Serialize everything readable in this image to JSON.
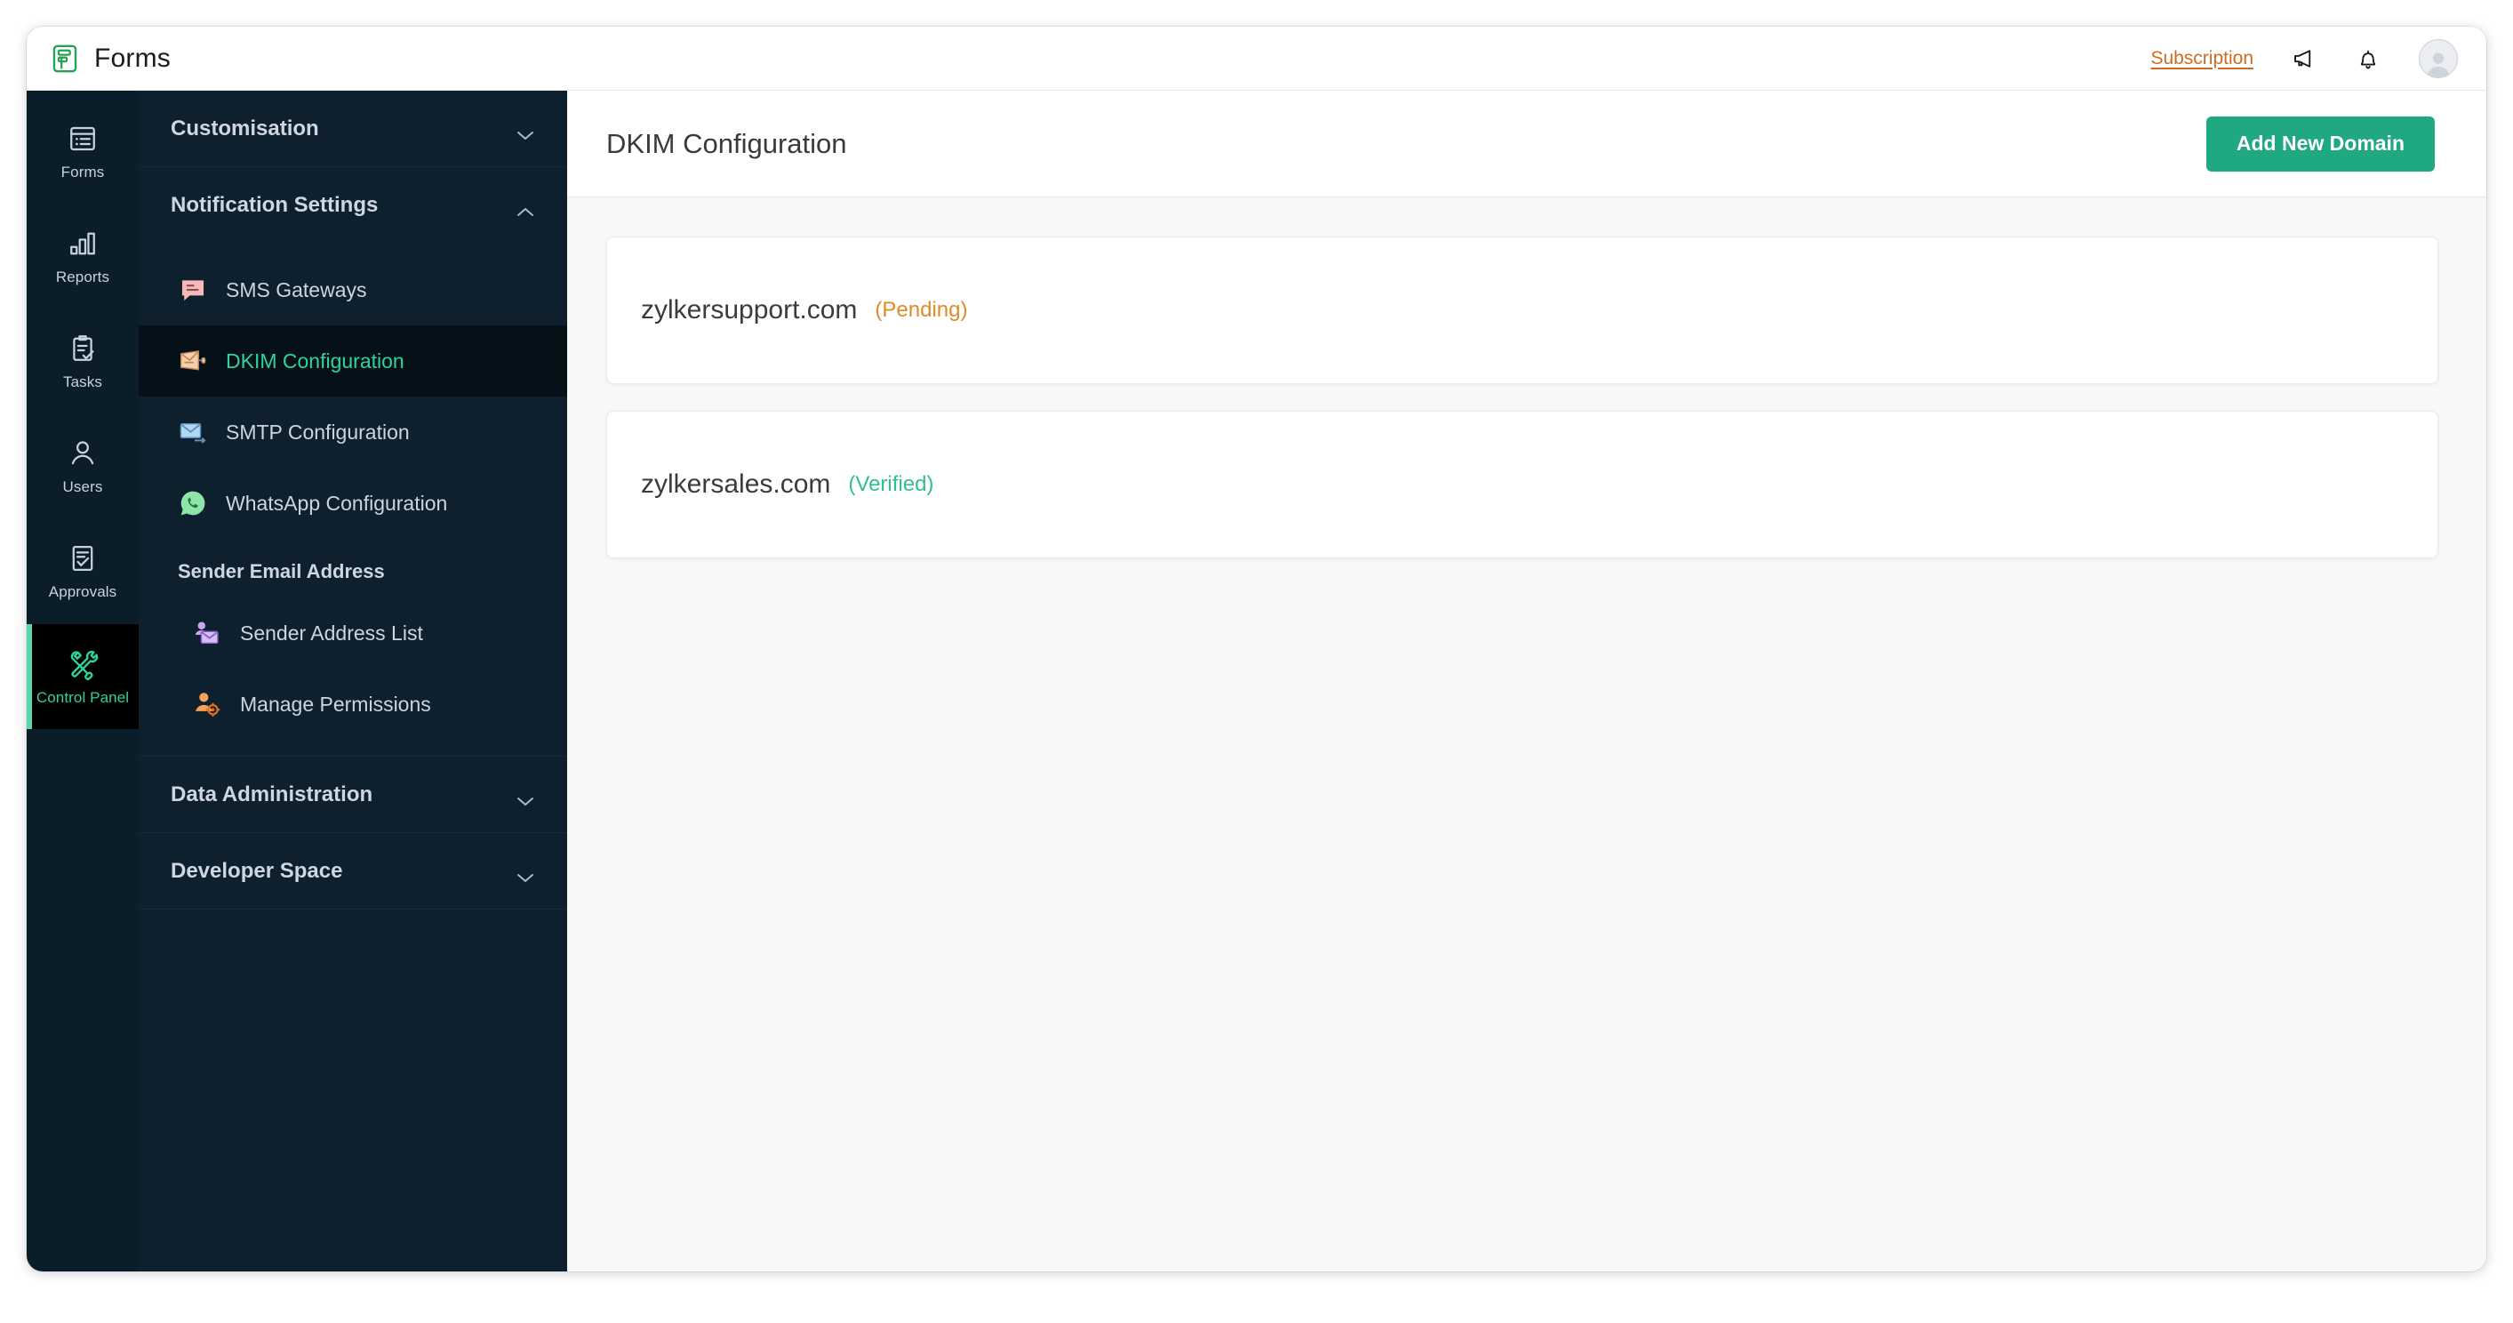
{
  "topbar": {
    "brand": "Forms",
    "logo_icon": "forms-logo-icon",
    "subscription_label": "Subscription",
    "announce_icon": "megaphone-icon",
    "notification_icon": "bell-icon",
    "avatar_icon": "user-avatar"
  },
  "rail": {
    "items": [
      {
        "label": "Forms",
        "icon": "forms-icon",
        "active": false
      },
      {
        "label": "Reports",
        "icon": "bar-chart-icon",
        "active": false
      },
      {
        "label": "Tasks",
        "icon": "clipboard-check-icon",
        "active": false
      },
      {
        "label": "Users",
        "icon": "user-icon",
        "active": false
      },
      {
        "label": "Approvals",
        "icon": "approval-document-icon",
        "active": false
      },
      {
        "label": "Control Panel",
        "icon": "tools-icon",
        "active": true
      }
    ]
  },
  "sidebar": {
    "sections": [
      {
        "title": "Customisation",
        "expanded": false,
        "chevron": "chevron-down-icon"
      },
      {
        "title": "Notification Settings",
        "expanded": true,
        "chevron": "chevron-up-icon"
      },
      {
        "title": "Data Administration",
        "expanded": false,
        "chevron": "chevron-down-icon"
      },
      {
        "title": "Developer Space",
        "expanded": false,
        "chevron": "chevron-down-icon"
      }
    ],
    "notification_items": [
      {
        "label": "SMS Gateways",
        "icon": "sms-bubble-icon",
        "active": false
      },
      {
        "label": "DKIM Configuration",
        "icon": "envelope-key-icon",
        "active": true
      },
      {
        "label": "SMTP Configuration",
        "icon": "envelope-send-icon",
        "active": false
      },
      {
        "label": "WhatsApp Configuration",
        "icon": "whatsapp-icon",
        "active": false
      }
    ],
    "sender_subhead": "Sender Email Address",
    "sender_items": [
      {
        "label": "Sender Address List",
        "icon": "user-envelope-icon",
        "active": false
      },
      {
        "label": "Manage Permissions",
        "icon": "user-gear-icon",
        "active": false
      }
    ]
  },
  "main": {
    "title": "DKIM Configuration",
    "add_button_label": "Add New Domain",
    "domains": [
      {
        "name": "zylkersupport.com",
        "status": "(Pending)",
        "state": "pending"
      },
      {
        "name": "zylkersales.com",
        "status": "(Verified)",
        "state": "verified"
      }
    ]
  },
  "colors": {
    "accent_green": "#1fa882",
    "active_green": "#2fd39b",
    "subscription_orange": "#cf6b21",
    "pending_orange": "#e08b2a",
    "verified_green": "#2fbf92",
    "rail_bg": "#0c1d2a",
    "sidebar_bg": "#0e1f2d",
    "content_bg": "#f7f8f8"
  }
}
